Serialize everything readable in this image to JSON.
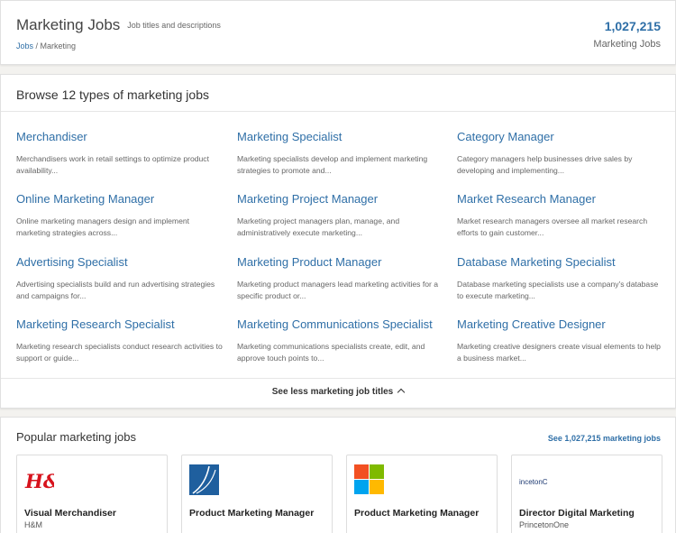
{
  "header": {
    "title": "Marketing Jobs",
    "subtitle": "Job titles and descriptions",
    "breadcrumb": {
      "root": "Jobs",
      "separator": " / ",
      "current": "Marketing"
    },
    "count": "1,027,215",
    "count_label": "Marketing Jobs"
  },
  "browse": {
    "title": "Browse 12 types of marketing jobs",
    "jobs": [
      {
        "title": "Merchandiser",
        "desc": "Merchandisers work in retail settings to optimize product availability..."
      },
      {
        "title": "Marketing Specialist",
        "desc": "Marketing specialists develop and implement marketing strategies to promote and..."
      },
      {
        "title": "Category Manager",
        "desc": "Category managers help businesses drive sales by developing and implementing..."
      },
      {
        "title": "Online Marketing Manager",
        "desc": "Online marketing managers design and implement marketing strategies across..."
      },
      {
        "title": "Marketing Project Manager",
        "desc": "Marketing project managers plan, manage, and administratively execute marketing..."
      },
      {
        "title": "Market Research Manager",
        "desc": "Market research managers oversee all market research efforts to gain customer..."
      },
      {
        "title": "Advertising Specialist",
        "desc": "Advertising specialists build and run advertising strategies and campaigns for..."
      },
      {
        "title": "Marketing Product Manager",
        "desc": "Marketing product managers lead marketing activities for a specific product or..."
      },
      {
        "title": "Database Marketing Specialist",
        "desc": "Database marketing specialists use a company's database to execute marketing..."
      },
      {
        "title": "Marketing Research Specialist",
        "desc": "Marketing research specialists conduct research activities to support or guide..."
      },
      {
        "title": "Marketing Communications Specialist",
        "desc": "Marketing communications specialists create, edit, and approve touch points to..."
      },
      {
        "title": "Marketing Creative Designer",
        "desc": "Marketing creative designers create visual elements to help a business market..."
      }
    ],
    "see_less": "See less marketing job titles"
  },
  "popular": {
    "title": "Popular marketing jobs",
    "see_all": "See 1,027,215 marketing jobs",
    "cards": [
      {
        "title": "Visual Merchandiser",
        "company": "H&M",
        "logo": "hm-logo",
        "logo_text": "H&M"
      },
      {
        "title": "Product Marketing Manager",
        "company": "",
        "logo": "blue-square-logo",
        "logo_text": ""
      },
      {
        "title": "Product Marketing Manager",
        "company": "",
        "logo": "microsoft-logo",
        "logo_text": ""
      },
      {
        "title": "Director Digital Marketing",
        "company": "PrincetonOne",
        "logo": "princetonone-logo",
        "logo_text": "incetonC"
      }
    ]
  },
  "colors": {
    "link": "#2f6fa7",
    "hm_red": "#d7131d",
    "ms_red": "#f25022",
    "ms_green": "#7fba00",
    "ms_blue": "#00a4ef",
    "ms_yellow": "#ffb900",
    "blue_logo": "#1f5f9e"
  }
}
